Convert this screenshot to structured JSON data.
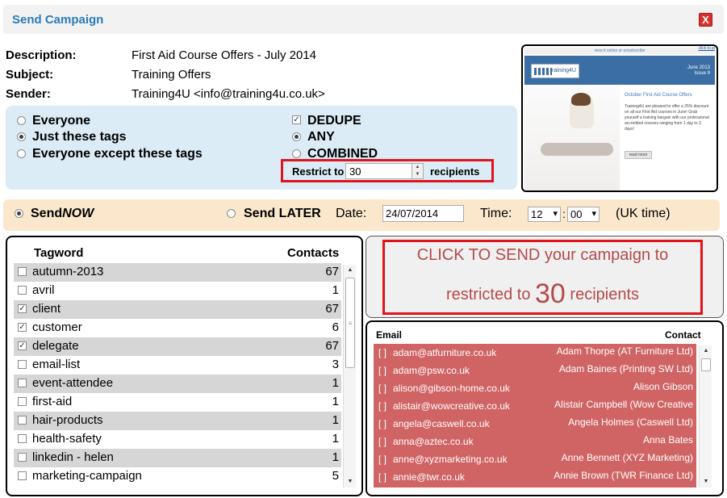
{
  "dialog": {
    "title": "Send Campaign",
    "close_glyph": "X"
  },
  "info": {
    "description_label": "Description:",
    "description_value": "First Aid Course Offers - July 2014",
    "subject_label": "Subject:",
    "subject_value": "Training Offers",
    "sender_label": "Sender:",
    "sender_value": "Training4U <info@training4u.co.uk>"
  },
  "preview": {
    "top_text": "view it online or unsubscribe",
    "click_text": "click to pl",
    "logo_text": "training4U",
    "issue_line1": "June 2013",
    "issue_line2": "Issue 9",
    "heading": "October First Aid Course Offers",
    "body": "Training4U are pleased to offer a 25% discount on all our First Aid courses in June! Grab yourself a training bargain with our professional accredited courses ranging from 1 day to 3 days!",
    "read_more": "read more"
  },
  "audience": {
    "options": [
      "Everyone",
      "Just these tags",
      "Everyone except these tags"
    ],
    "selected": 1,
    "dedupe_label": "DEDUPE",
    "dedupe_checked": true,
    "match_options": [
      "ANY",
      "COMBINED"
    ],
    "match_selected": 0,
    "restrict_label": "Restrict to",
    "restrict_value": "30",
    "recipients_label": "recipients"
  },
  "send_time": {
    "now_label_a": "Send",
    "now_label_b": "NOW",
    "later_label": "Send LATER",
    "date_label": "Date:",
    "date_value": "24/07/2014",
    "time_label": "Time:",
    "hour": "12",
    "minute": "00",
    "colon": ":",
    "tz_note": "(UK time)",
    "dropdown_glyph": "▾"
  },
  "tags": {
    "header_word": "Tagword",
    "header_contacts": "Contacts",
    "rows": [
      {
        "name": "autumn-2013",
        "count": "67",
        "checked": false
      },
      {
        "name": "avril",
        "count": "1",
        "checked": false
      },
      {
        "name": "client",
        "count": "67",
        "checked": true
      },
      {
        "name": "customer",
        "count": "6",
        "checked": true
      },
      {
        "name": "delegate",
        "count": "67",
        "checked": true
      },
      {
        "name": "email-list",
        "count": "3",
        "checked": false
      },
      {
        "name": "event-attendee",
        "count": "1",
        "checked": false
      },
      {
        "name": "first-aid",
        "count": "1",
        "checked": false
      },
      {
        "name": "hair-products",
        "count": "1",
        "checked": false
      },
      {
        "name": "health-safety",
        "count": "1",
        "checked": false
      },
      {
        "name": "linkedin - helen",
        "count": "1",
        "checked": false
      },
      {
        "name": "marketing-campaign",
        "count": "5",
        "checked": false
      }
    ]
  },
  "send_button": {
    "line1": "CLICK TO SEND your campaign to",
    "line2_prefix": "restricted to",
    "count": "30",
    "line2_suffix": "recipients"
  },
  "recipients": {
    "header_email": "Email",
    "header_contact": "Contact",
    "bracket": "[ ]",
    "rows": [
      {
        "email": "adam@atfurniture.co.uk",
        "contact": "Adam Thorpe (AT Furniture Ltd)"
      },
      {
        "email": "adam@psw.co.uk",
        "contact": "Adam Baines (Printing SW Ltd)"
      },
      {
        "email": "alison@gibson-home.co.uk",
        "contact": "Alison Gibson"
      },
      {
        "email": "alistair@wowcreative.co.uk",
        "contact": "Alistair Campbell (Wow Creative"
      },
      {
        "email": "angela@caswell.co.uk",
        "contact": "Angela Holmes (Caswell Ltd)"
      },
      {
        "email": "anna@aztec.co.uk",
        "contact": "Anna Bates"
      },
      {
        "email": "anne@xyzmarketing.co.uk",
        "contact": "Anne Bennett (XYZ Marketing)"
      },
      {
        "email": "annie@twr.co.uk",
        "contact": "Annie Brown (TWR Finance Ltd)"
      }
    ]
  },
  "scroll": {
    "up_glyph": "▲",
    "down_glyph": "▼",
    "grip_glyph": "≡"
  }
}
